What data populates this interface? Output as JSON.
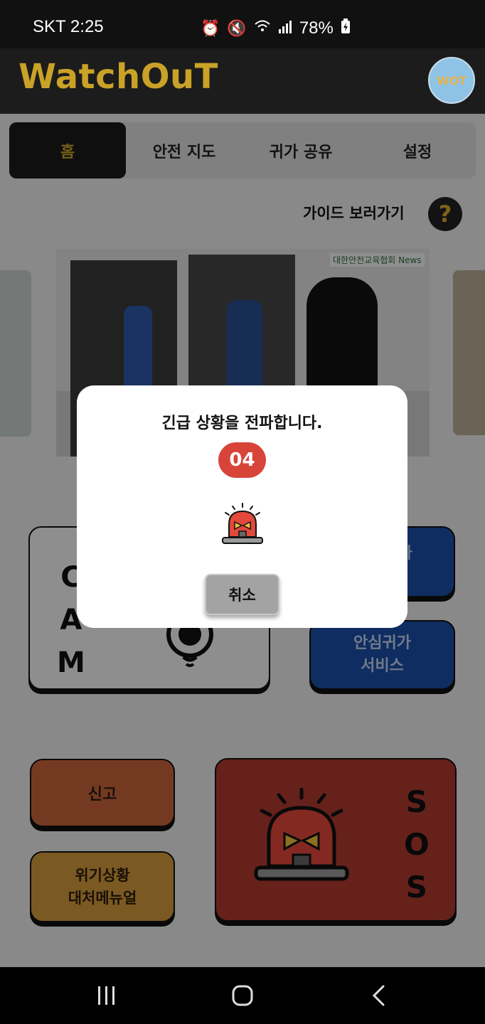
{
  "status_bar": {
    "carrier": "SKT",
    "time": "2:25",
    "battery": "78%",
    "icons": [
      "alarm-icon",
      "mute-icon",
      "wifi-icon",
      "signal-icon",
      "battery-charging-icon"
    ]
  },
  "app": {
    "title": "WatchOuT",
    "avatar_label": "WOT"
  },
  "tabs": [
    {
      "label": "홈",
      "active": true
    },
    {
      "label": "안전 지도",
      "active": false
    },
    {
      "label": "귀가 공유",
      "active": false
    },
    {
      "label": "설정",
      "active": false
    }
  ],
  "guide": {
    "label": "가이드 보러가기",
    "icon": "?"
  },
  "banner": {
    "watermark": "대한안전교육협회 News"
  },
  "menu": {
    "cam_letters": [
      "C",
      "A",
      "M"
    ],
    "blue_top_partial": "다",
    "safe_return": [
      "안심귀가",
      "서비스"
    ],
    "report": "신고",
    "crisis_manual": [
      "위기상황",
      "대처메뉴얼"
    ],
    "sos_letters": [
      "S",
      "O",
      "S"
    ]
  },
  "modal": {
    "title": "긴급 상황을 전파합니다.",
    "countdown": "04",
    "cancel_label": "취소"
  },
  "colors": {
    "brand_gold": "#c9a227",
    "countdown_red": "#d9443a",
    "sos_red": "#b03a30",
    "service_blue": "#1a4fa6"
  }
}
